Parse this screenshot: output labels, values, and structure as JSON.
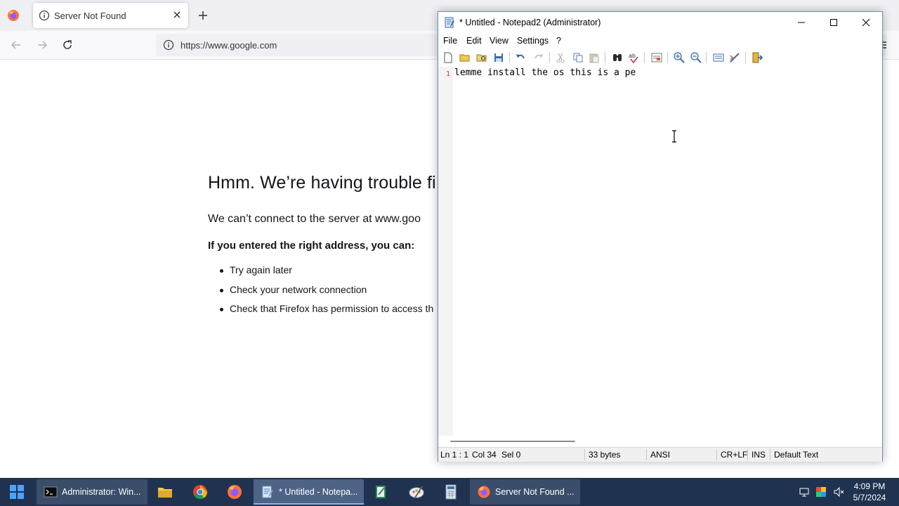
{
  "browser": {
    "tab": {
      "title": "Server Not Found"
    },
    "url": "https://www.google.com",
    "error": {
      "heading": "Hmm. We’re having trouble fi",
      "message": "We can’t connect to the server at www.goo",
      "subheading": "If you entered the right address, you can:",
      "suggestions": [
        "Try again later",
        "Check your network connection",
        "Check that Firefox has permission to access th"
      ]
    }
  },
  "notepad": {
    "title": "* Untitled - Notepad2 (Administrator)",
    "menu": [
      "File",
      "Edit",
      "View",
      "Settings",
      "?"
    ],
    "line_number": "1",
    "content": "lemme install the os this is a pe",
    "status": {
      "position": "Ln 1 : 1",
      "column": "Col 34",
      "selection": "Sel 0",
      "size": "33 bytes",
      "encoding": "ANSI",
      "line_endings": "CR+LF",
      "mode": "INS",
      "scheme": "Default Text"
    }
  },
  "taskbar": {
    "items": [
      {
        "label": "Administrator: Win...",
        "icon": "terminal-icon"
      },
      {
        "label": "* Untitled - Notepa...",
        "icon": "notepad2-icon"
      },
      {
        "label": "Server Not Found ...",
        "icon": "firefox-icon"
      }
    ],
    "pinned": [
      "file-explorer-icon",
      "chrome-icon",
      "firefox-icon",
      "notepad2-icon",
      "paint-icon",
      "calculator-icon"
    ],
    "clock": {
      "time": "4:09 PM",
      "date": "5/7/2024"
    }
  },
  "colors": {
    "taskbar": "#1f3250",
    "firefox_tabbar": "#f0f0f4",
    "line_number": "#c83232"
  }
}
